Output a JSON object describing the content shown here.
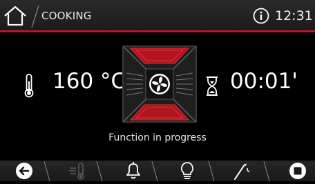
{
  "header": {
    "title": "COOKING",
    "clock": "12:31",
    "icons": {
      "home": "home-icon",
      "info": "info-icon"
    }
  },
  "main": {
    "temperature": "160 °C",
    "timer": "00:01'",
    "status": "Function in progress",
    "icons": {
      "temperature": "thermometer-icon",
      "timer": "hourglass-icon",
      "fan": "fan-icon"
    }
  },
  "bottom_bar": {
    "items": [
      {
        "name": "back-icon",
        "enabled": true
      },
      {
        "name": "preheat-icon",
        "enabled": false
      },
      {
        "name": "bell-icon",
        "enabled": true
      },
      {
        "name": "light-bulb-icon",
        "enabled": true
      },
      {
        "name": "probe-icon",
        "enabled": true
      },
      {
        "name": "stop-icon",
        "enabled": true
      }
    ]
  },
  "colors": {
    "accent": "#c8102e",
    "background": "#000000",
    "header": "#222222"
  }
}
